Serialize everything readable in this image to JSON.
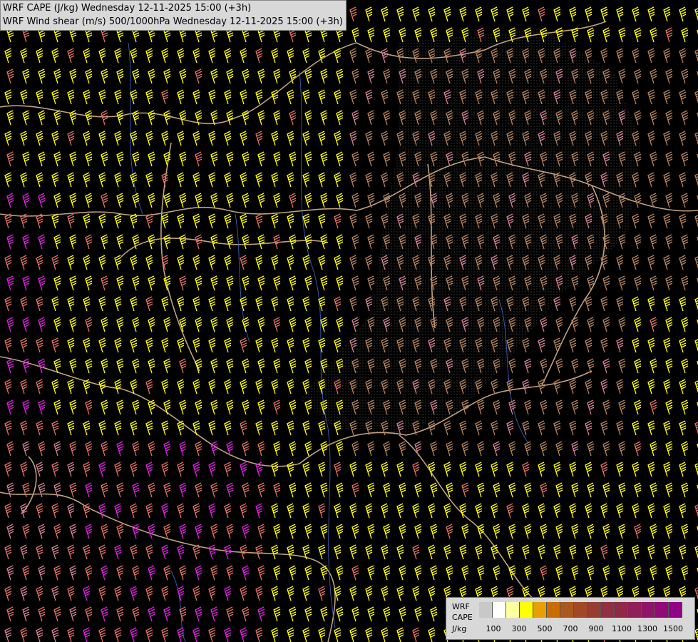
{
  "header": {
    "line1": "WRF CAPE (J/kg) Wednesday 12-11-2025 15:00 (+3h)",
    "line2": "WRF Wind shear (m/s) 500/1000hPa Wednesday 12-11-2025 15:00 (+3h)"
  },
  "legend": {
    "label_model": "WRF",
    "label_field": "CAPE",
    "label_unit": "J/kg",
    "swatch_colors": [
      "#c8c8c8",
      "#ffffff",
      "#ffff9e",
      "#ffff00",
      "#e8a000",
      "#c86e00",
      "#a85a1e",
      "#a04828",
      "#983c30",
      "#903040",
      "#902848",
      "#901e58",
      "#901468",
      "#900a78",
      "#900088"
    ],
    "ticks": [
      "100",
      "300",
      "500",
      "700",
      "900",
      "1100",
      "1300",
      "1500"
    ]
  },
  "colors": {
    "background": "#000000",
    "border": "#d6b48c",
    "river": "#4466cc",
    "barb_yellow": "#ffff00",
    "barb_tan": "#b4825a",
    "barb_salmon": "#e07060",
    "barb_magenta": "#e020e0",
    "barb_pink": "#d08090"
  },
  "icons": [
    "wind-barb-icon"
  ]
}
